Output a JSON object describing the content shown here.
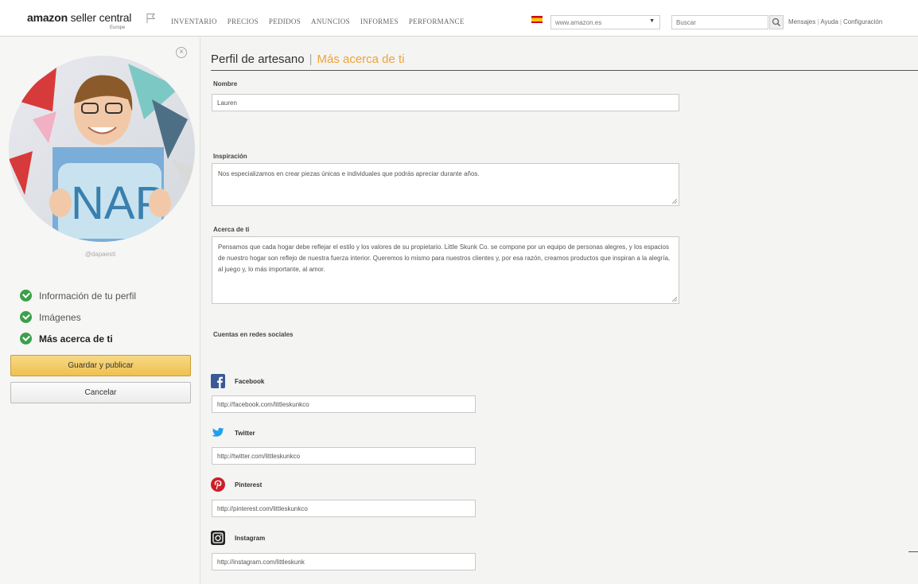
{
  "header": {
    "logo_bold": "amazon",
    "logo_rest": " seller central",
    "logo_sub": "Europe",
    "nav": [
      "INVENTARIO",
      "PRECIOS",
      "PEDIDOS",
      "ANUNCIOS",
      "INFORMES",
      "PERFORMANCE"
    ],
    "marketplace": "www.amazon.es",
    "search_placeholder": "Buscar",
    "links": [
      "Mensajes",
      "Ayuda",
      "Configuración"
    ]
  },
  "sidebar": {
    "username": "@dapaesti",
    "steps": [
      {
        "label": "Información de tu perfil",
        "done": true
      },
      {
        "label": "Imágenes",
        "done": true
      },
      {
        "label": "Más acerca de ti",
        "done": true,
        "active": true
      }
    ],
    "save_label": "Guardar y publicar",
    "cancel_label": "Cancelar"
  },
  "page": {
    "title": "Perfil de artesano",
    "separator": "|",
    "subtitle": "Más acerca de ti"
  },
  "form": {
    "nombre_label": "Nombre",
    "nombre_value": "Lauren",
    "inspiracion_label": "Inspiración",
    "inspiracion_value": "Nos especializamos en crear piezas únicas e individuales que podrás apreciar durante años.",
    "acerca_label": "Acerca de ti",
    "acerca_value": "Pensamos que cada hogar debe reflejar el estilo y los valores de su propietario. Little Skunk Co. se compone por un equipo de personas alegres, y los espacios de nuestro hogar son reflejo de nuestra fuerza interior. Queremos lo mismo para nuestros clientes y, por esa razón, creamos productos que inspiran a la alegría, al juego y, lo más importante, al amor.",
    "social_label": "Cuentas en redes sociales"
  },
  "social": [
    {
      "name": "Facebook",
      "icon": "facebook-icon",
      "url": "http://facebook.com/littleskunkco",
      "color": "#3b5998"
    },
    {
      "name": "Twitter",
      "icon": "twitter-icon",
      "url": "http://twitter.com/littleskunkco",
      "color": "#1da1f2"
    },
    {
      "name": "Pinterest",
      "icon": "pinterest-icon",
      "url": "http://pinterest.com/littleskunkco",
      "color": "#cb2027"
    },
    {
      "name": "Instagram",
      "icon": "instagram-icon",
      "url": "http://instagram.com/littleskunk",
      "color": "#222222"
    }
  ],
  "colors": {
    "accent_orange": "#f0a235",
    "primary_button": "#efc14f",
    "check_green": "#3aa04a"
  }
}
